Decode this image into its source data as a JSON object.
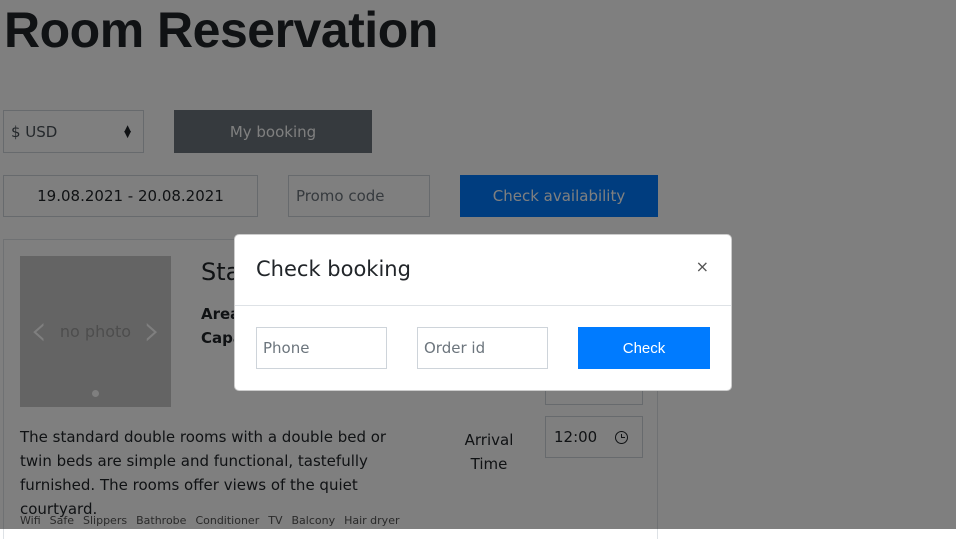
{
  "page": {
    "title": "Room Reservation"
  },
  "toolbar": {
    "currency": "$ USD",
    "my_booking_label": "My booking"
  },
  "search": {
    "dates": "19.08.2021 - 20.08.2021",
    "promo_placeholder": "Promo code",
    "check_availability_label": "Check availability"
  },
  "room": {
    "name": "Sta",
    "area_label": "Area",
    "capacity_label": "Capa",
    "photo_placeholder": "no photo",
    "description": "The standard double rooms with a double bed or twin beds are simple and functional, tastefully furnished. The rooms offer views of the quiet courtyard.",
    "arrival_label": "Arrival Time",
    "arrival_time": "12:00",
    "amenities": [
      "Wifi",
      "Safe",
      "Slippers",
      "Bathrobe",
      "Conditioner",
      "TV",
      "Balcony",
      "Hair dryer"
    ]
  },
  "modal": {
    "title": "Check booking",
    "close": "×",
    "phone_placeholder": "Phone",
    "order_placeholder": "Order id",
    "check_label": "Check"
  },
  "colors": {
    "primary": "#007bff",
    "secondary": "#6c757d",
    "backdrop": "rgba(0,0,0,0.5)"
  }
}
